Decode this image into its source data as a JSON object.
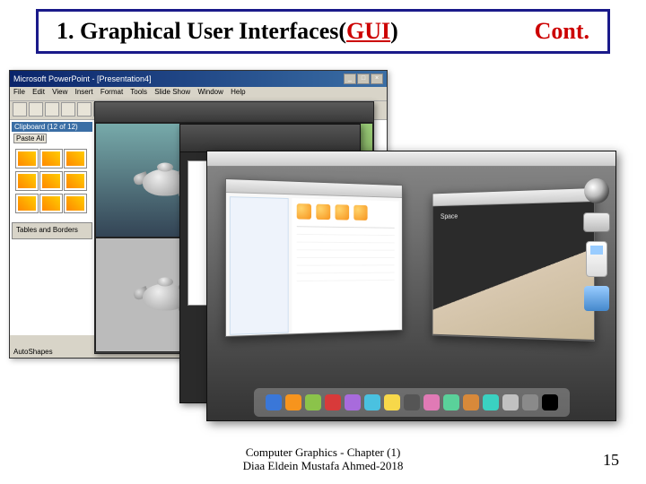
{
  "title": {
    "prefix": "1. Graphical User Interfaces(",
    "gui": "GUI",
    "suffix": ")",
    "cont": "Cont."
  },
  "ppt": {
    "window_title": "Microsoft PowerPoint - [Presentation4]",
    "menu": [
      "File",
      "Edit",
      "View",
      "Insert",
      "Format",
      "Tools",
      "Slide Show",
      "Window",
      "Help"
    ],
    "clipboard_header": "Clipboard (12 of 12)",
    "paste_all": "Paste All",
    "tables_borders": "Tables and Borders",
    "autoshapes": "AutoShapes"
  },
  "spacewin": {
    "label": "Space"
  },
  "dock_colors": [
    "#3a77d8",
    "#f7941d",
    "#8bc34a",
    "#d83a3a",
    "#a86bdc",
    "#4ac1e0",
    "#f7d84a",
    "#555",
    "#e07ab5",
    "#5ad19a",
    "#d8893a",
    "#3ad1c1",
    "#c1c1c1",
    "#8a8a8a",
    "#000"
  ],
  "footer": {
    "line1": "Computer Graphics - Chapter (1)",
    "line2": "Diaa Eldein Mustafa Ahmed-2018"
  },
  "page_number": "15"
}
